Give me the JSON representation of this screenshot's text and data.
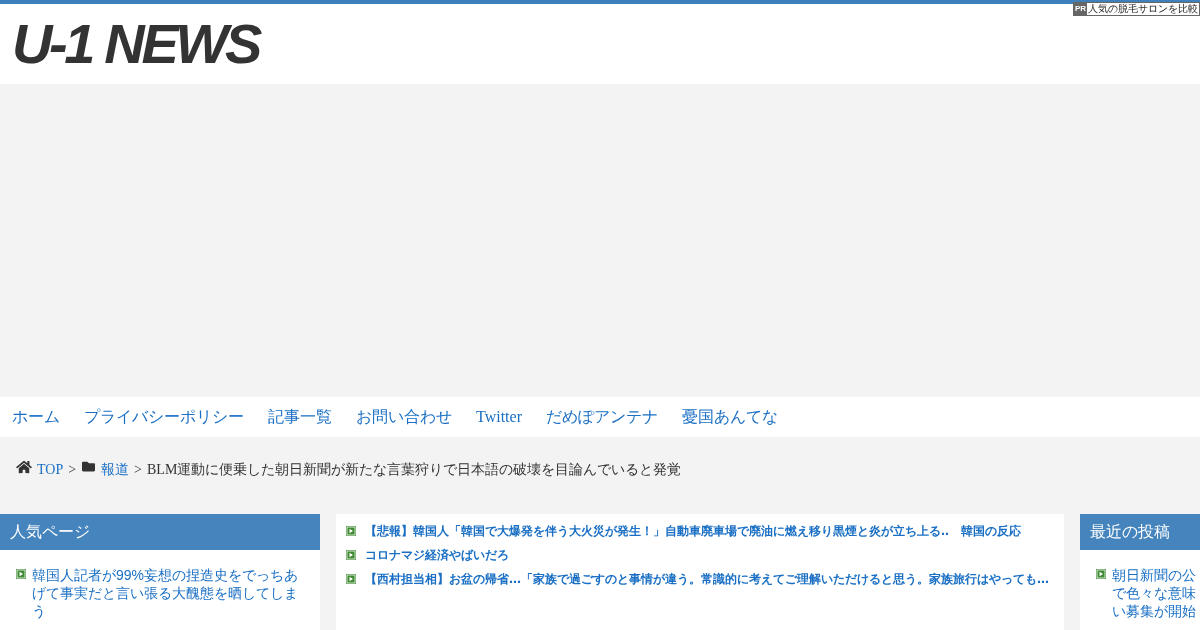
{
  "ad_label": {
    "badge": "PR",
    "text": "人気の脱毛サロンを比較"
  },
  "header": {
    "logo": "U-1 NEWS"
  },
  "nav": {
    "items": [
      {
        "label": "ホーム"
      },
      {
        "label": "プライバシーポリシー"
      },
      {
        "label": "記事一覧"
      },
      {
        "label": "お問い合わせ"
      },
      {
        "label": "Twitter"
      },
      {
        "label": "だめぽアンテナ"
      },
      {
        "label": "憂国あんてな"
      }
    ]
  },
  "breadcrumb": [
    {
      "kind": "home",
      "label": "TOP",
      "separator": ">"
    },
    {
      "kind": "category",
      "label": "報道",
      "separator": ">"
    },
    {
      "kind": "current",
      "label": "BLM運動に便乗した朝日新聞が新たな言葉狩りで日本語の破壊を目論んでいると発覚"
    }
  ],
  "popular_pages": {
    "title": "人気ページ",
    "items": [
      "韓国人記者が99%妄想の捏造史をでっちあげて事実だと言い張る大醜態を晒してしまう"
    ]
  },
  "article_list": {
    "items": [
      "【悲報】韓国人「韓国で大爆発を伴う大火災が発生！」自動車廃車場で廃油に燃え移り黒煙と炎が立ち上る‥　韓国の反応",
      "コロナマジ経済やばいだろ",
      "【西村担当相】お盆の帰省…「家族で過ごすのと事情が違う。常識的に考えてご理解いただけると思う。家族旅行はやっても…"
    ]
  },
  "recent_posts": {
    "title": "最近の投稿",
    "items": [
      {
        "lines": [
          "朝日新聞の公",
          "で色々な意味",
          "い募集が開始"
        ]
      }
    ]
  }
}
